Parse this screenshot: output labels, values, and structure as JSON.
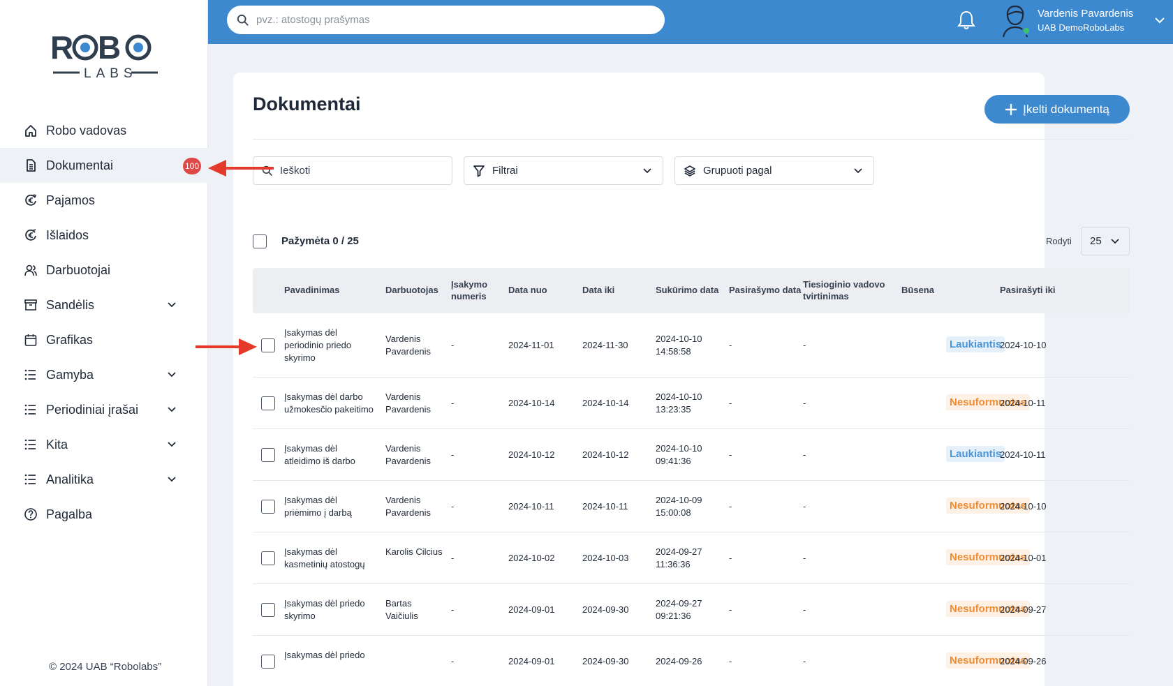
{
  "sidebar": {
    "logo": {
      "top": "ROBO",
      "bottom": "LABS"
    },
    "items": [
      {
        "label": "Robo vadovas",
        "icon": "home-icon",
        "name": "sidebar-item-robo-vadovas",
        "chevron": false
      },
      {
        "label": "Dokumentai",
        "icon": "document-icon",
        "name": "sidebar-item-dokumentai",
        "active": true,
        "badge": "100"
      },
      {
        "label": "Pajamos",
        "icon": "euro-in-icon",
        "name": "sidebar-item-pajamos"
      },
      {
        "label": "Išlaidos",
        "icon": "euro-out-icon",
        "name": "sidebar-item-islaidos"
      },
      {
        "label": "Darbuotojai",
        "icon": "users-icon",
        "name": "sidebar-item-darbuotojai"
      },
      {
        "label": "Sandėlis",
        "icon": "archive-icon",
        "name": "sidebar-item-sandelis",
        "chevron": true
      },
      {
        "label": "Grafikas",
        "icon": "calendar-icon",
        "name": "sidebar-item-grafikas"
      },
      {
        "label": "Gamyba",
        "icon": "list-icon",
        "name": "sidebar-item-gamyba",
        "chevron": true
      },
      {
        "label": "Periodiniai įrašai",
        "icon": "list-icon",
        "name": "sidebar-item-periodiniai-irasai",
        "chevron": true
      },
      {
        "label": "Kita",
        "icon": "list-icon",
        "name": "sidebar-item-kita",
        "chevron": true
      },
      {
        "label": "Analitika",
        "icon": "list-icon",
        "name": "sidebar-item-analitika",
        "chevron": true
      },
      {
        "label": "Pagalba",
        "icon": "help-icon",
        "name": "sidebar-item-pagalba"
      }
    ],
    "copyright": "© 2024 UAB “Robolabs”"
  },
  "header": {
    "search_placeholder": "pvz.: atostogų prašymas",
    "user_name": "Vardenis Pavardenis",
    "company": "UAB DemoRoboLabs"
  },
  "main": {
    "title": "Dokumentai",
    "upload_label": "Įkelti dokumentą",
    "search_placeholder": "Ieškoti",
    "filters_label": "Filtrai",
    "group_label": "Grupuoti pagal",
    "selected_label": "Pažymėta 0 / 25",
    "show_label": "Rodyti",
    "show_value": "25",
    "columns": [
      "Pavadinimas",
      "Darbuotojas",
      "Įsakymo numeris",
      "Data nuo",
      "Data iki",
      "Sukūrimo data",
      "Pasirašymo data",
      "Tiesioginio vadovo tvirtinimas",
      "Būsena",
      "Pasirašyti iki"
    ],
    "rows": [
      {
        "name": "Įsakymas dėl periodinio priedo skyrimo",
        "employee": "Vardenis Pavardenis",
        "number": "-",
        "from": "2024-11-01",
        "to": "2024-11-30",
        "created": "2024-10-10 14:58:58",
        "signed": "-",
        "approval": "-",
        "status": "Laukiantis",
        "status_kind": "wait",
        "sign_until": "2024-10-10"
      },
      {
        "name": "Įsakymas dėl darbo užmokesčio pakeitimo",
        "employee": "Vardenis Pavardenis",
        "number": "-",
        "from": "2024-10-14",
        "to": "2024-10-14",
        "created": "2024-10-10 13:23:35",
        "signed": "-",
        "approval": "-",
        "status": "Nesuformuotas",
        "status_kind": "draft",
        "sign_until": "2024-10-11"
      },
      {
        "name": "Įsakymas dėl atleidimo iš darbo",
        "employee": "Vardenis Pavardenis",
        "number": "-",
        "from": "2024-10-12",
        "to": "2024-10-12",
        "created": "2024-10-10 09:41:36",
        "signed": "-",
        "approval": "-",
        "status": "Laukiantis",
        "status_kind": "wait",
        "sign_until": "2024-10-11"
      },
      {
        "name": "Įsakymas dėl priėmimo į darbą",
        "employee": "Vardenis Pavardenis",
        "number": "-",
        "from": "2024-10-11",
        "to": "2024-10-11",
        "created": "2024-10-09 15:00:08",
        "signed": "-",
        "approval": "-",
        "status": "Nesuformuotas",
        "status_kind": "draft",
        "sign_until": "2024-10-10"
      },
      {
        "name": "Įsakymas dėl kasmetinių atostogų",
        "employee": "Karolis Cilcius",
        "number": "-",
        "from": "2024-10-02",
        "to": "2024-10-03",
        "created": "2024-09-27 11:36:36",
        "signed": "-",
        "approval": "-",
        "status": "Nesuformuotas",
        "status_kind": "draft",
        "sign_until": "2024-10-01"
      },
      {
        "name": "Įsakymas dėl priedo skyrimo",
        "employee": "Bartas Vaičiulis",
        "number": "-",
        "from": "2024-09-01",
        "to": "2024-09-30",
        "created": "2024-09-27 09:21:36",
        "signed": "-",
        "approval": "-",
        "status": "Nesuformuotas",
        "status_kind": "draft",
        "sign_until": "2024-09-27"
      },
      {
        "name": "Įsakymas dėl priedo",
        "employee": "",
        "number": "-",
        "from": "2024-09-01",
        "to": "2024-09-30",
        "created": "2024-09-26",
        "signed": "-",
        "approval": "-",
        "status": "Nesuformuotas",
        "status_kind": "draft",
        "sign_until": "2024-09-26"
      }
    ]
  },
  "colors": {
    "brand_blue": "#3d89d0",
    "badge_red": "#e04848",
    "status_wait": "#4b95d6",
    "status_draft": "#ef8d34",
    "annotation_arrow": "#e5392b"
  }
}
